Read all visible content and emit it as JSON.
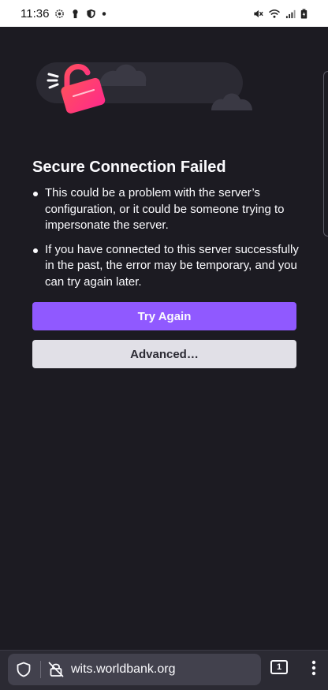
{
  "status_bar": {
    "time": "11:36",
    "left_icons": [
      "settings-gear-icon",
      "keyhole-icon",
      "shield-icon",
      "dot-icon"
    ],
    "right_icons": [
      "mute-icon",
      "wifi-icon",
      "signal-icon",
      "battery-charging-icon"
    ]
  },
  "error_page": {
    "title": "Secure Connection Failed",
    "reasons": [
      "This could be a problem with the server’s configuration, or it could be someone trying to impersonate the server.",
      "If you have connected to this server successfully in the past, the error may be temporary, and you can try again later."
    ],
    "try_again_label": "Try Again",
    "advanced_label": "Advanced…"
  },
  "toolbar": {
    "url": "wits.worldbank.org",
    "tab_count": "1"
  },
  "colors": {
    "page_background": "#1c1b22",
    "primary_button": "#9059ff",
    "secondary_button": "#e1e0e7",
    "toolbar": "#2b2a33",
    "url_box": "#42414d",
    "lock_gradient_start": "#ff4f5e",
    "lock_gradient_end": "#ff2a8a"
  }
}
